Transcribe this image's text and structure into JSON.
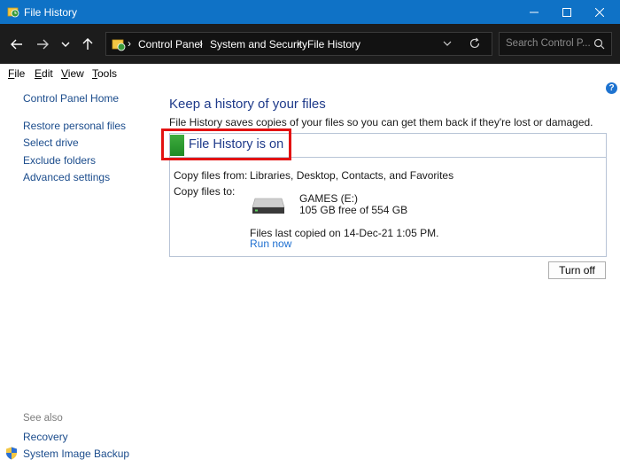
{
  "window": {
    "title": "File History",
    "accent": "#0f72c6"
  },
  "address": {
    "breadcrumbs": [
      "Control Panel",
      "System and Security",
      "File History"
    ],
    "location_icon": "control-panel-icon"
  },
  "search": {
    "placeholder": "Search Control P..."
  },
  "menu": {
    "items": [
      {
        "label": "File",
        "access": "F",
        "rest": "ile"
      },
      {
        "label": "Edit",
        "access": "E",
        "rest": "dit"
      },
      {
        "label": "View",
        "access": "V",
        "rest": "iew"
      },
      {
        "label": "Tools",
        "access": "T",
        "rest": "ools"
      }
    ]
  },
  "sidebar": {
    "home": "Control Panel Home",
    "links": [
      "Restore personal files",
      "Select drive",
      "Exclude folders",
      "Advanced settings"
    ],
    "see_also": "See also",
    "see_also_links": [
      "Recovery",
      "System Image Backup"
    ]
  },
  "main": {
    "heading": "Keep a history of your files",
    "description": "File History saves copies of your files so you can get them back if they're lost or damaged.",
    "status": "File History is on",
    "status_color": "#2e9e35",
    "copy_from_label": "Copy files from:",
    "copy_from_value": "Libraries, Desktop, Contacts, and Favorites",
    "copy_to_label": "Copy files to:",
    "drive_name": "GAMES (E:)",
    "drive_space": "105 GB free of 554 GB",
    "last_copied": "Files last copied on 14-Dec-21 1:05 PM.",
    "run_now": "Run now",
    "turn_off": "Turn off"
  }
}
